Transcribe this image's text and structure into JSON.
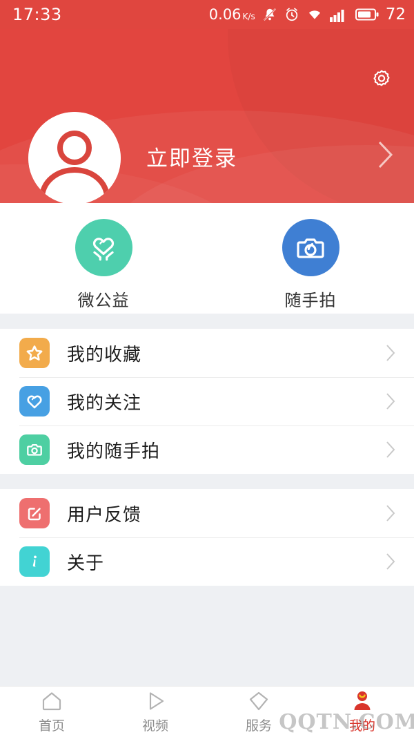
{
  "status_bar": {
    "time": "17:33",
    "network_speed": "0.06",
    "speed_unit": "K/s",
    "battery_level": "72",
    "icons": [
      "mute-bell-icon",
      "alarm-clock-icon",
      "wifi-icon",
      "signal-bars-icon",
      "battery-icon"
    ]
  },
  "header": {
    "background_color": "#e2453f",
    "settings_icon": "gear-icon",
    "avatar_icon": "default-user-avatar-icon",
    "login_label": "立即登录",
    "chevron_icon": "chevron-right-icon"
  },
  "shortcuts": [
    {
      "label": "微公益",
      "icon": "heart-in-hands-icon",
      "color": "#4ecfad"
    },
    {
      "label": "随手拍",
      "icon": "camera-icon",
      "color": "#3f7fd3"
    }
  ],
  "menu_groups": [
    {
      "items": [
        {
          "label": "我的收藏",
          "icon": "star-icon",
          "color": "#f2ab4b"
        },
        {
          "label": "我的关注",
          "icon": "heart-icon",
          "color": "#47a0e3"
        },
        {
          "label": "我的随手拍",
          "icon": "camera-icon",
          "color": "#4ecfa2"
        }
      ]
    },
    {
      "items": [
        {
          "label": "用户反馈",
          "icon": "edit-feedback-icon",
          "color": "#ee6f6f"
        },
        {
          "label": "关于",
          "icon": "info-icon",
          "color": "#42d3d3"
        }
      ]
    }
  ],
  "tab_bar": {
    "active_color": "#d9352c",
    "inactive_color": "#8c8c8c",
    "items": [
      {
        "label": "首页",
        "icon": "home-icon",
        "active": false
      },
      {
        "label": "视频",
        "icon": "play-triangle-icon",
        "active": false
      },
      {
        "label": "服务",
        "icon": "diamond-icon",
        "active": false
      },
      {
        "label": "我的",
        "icon": "person-icon",
        "active": true
      }
    ]
  },
  "watermark": {
    "text": "QQTN.COM"
  }
}
